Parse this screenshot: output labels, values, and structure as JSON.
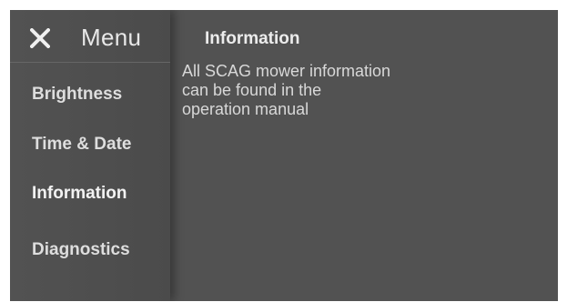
{
  "menu": {
    "close_icon": "close-icon",
    "title": "Menu",
    "items": [
      {
        "label": "Brightness"
      },
      {
        "label": "Time & Date"
      },
      {
        "label": "Information",
        "active": true
      },
      {
        "label": "Diagnostics"
      }
    ]
  },
  "content": {
    "title": "Information",
    "text_lines": [
      "All SCAG mower information",
      "can be found in the",
      "operation manual"
    ]
  }
}
